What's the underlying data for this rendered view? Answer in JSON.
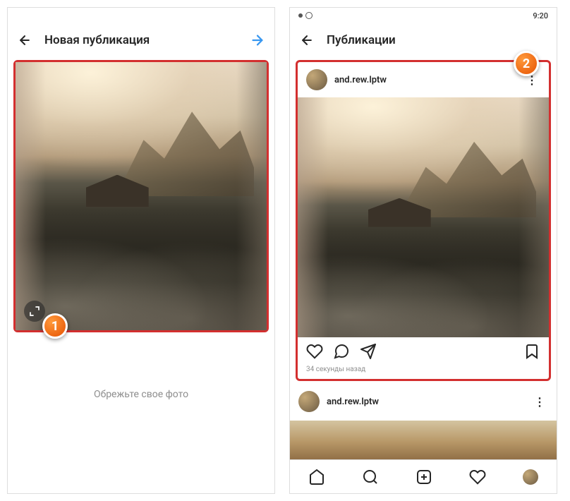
{
  "phone1": {
    "header": {
      "title": "Новая публикация"
    },
    "crop_hint": "Обрежьте свое фото",
    "badge": "1"
  },
  "phone2": {
    "status": {
      "time": "9:20"
    },
    "header": {
      "title": "Публикации"
    },
    "badge": "2",
    "post": {
      "username": "and.rew.lptw",
      "timestamp": "34 секунды назад"
    },
    "post2": {
      "username": "and.rew.lptw"
    }
  }
}
